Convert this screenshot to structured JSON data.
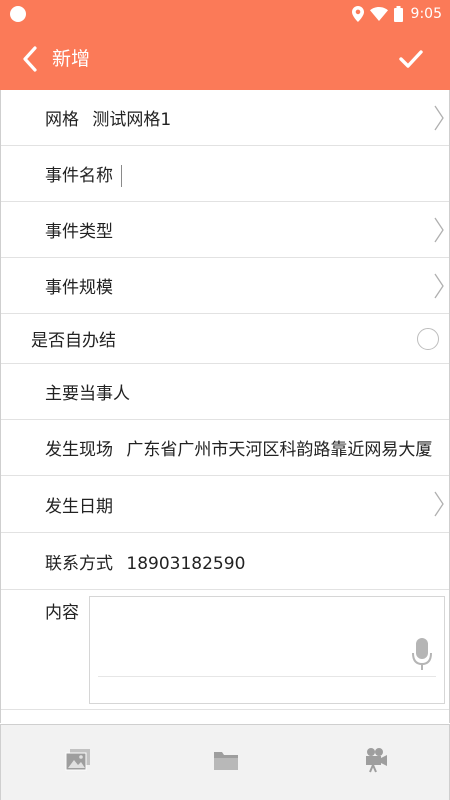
{
  "status_bar": {
    "time": "9:05",
    "icons": [
      "notification-dot-icon",
      "location-icon",
      "wifi-icon",
      "battery-icon"
    ]
  },
  "app_bar": {
    "title": "新增",
    "back_icon": "chevron-left-icon",
    "confirm_icon": "check-icon"
  },
  "colors": {
    "accent": "#fb7a58"
  },
  "form": {
    "grid": {
      "label": "网格",
      "value": "测试网格1"
    },
    "event_name": {
      "label": "事件名称",
      "value": ""
    },
    "event_type": {
      "label": "事件类型"
    },
    "event_scale": {
      "label": "事件规模"
    },
    "self_handled": {
      "label": "是否自办结",
      "checked": false
    },
    "main_party": {
      "label": "主要当事人",
      "value": ""
    },
    "location": {
      "label": "发生现场",
      "value": "广东省广州市天河区科韵路靠近网易大厦"
    },
    "date": {
      "label": "发生日期"
    },
    "contact": {
      "label": "联系方式",
      "value": "18903182590"
    },
    "content": {
      "label": "内容",
      "value": ""
    }
  },
  "bottom_bar": {
    "buttons": [
      "image-icon",
      "folder-icon",
      "video-camera-icon"
    ]
  }
}
